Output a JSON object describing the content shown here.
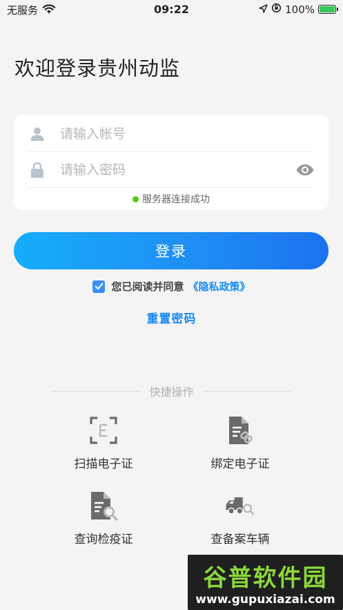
{
  "status_bar": {
    "carrier": "无服务",
    "time": "09:22",
    "battery": "100%"
  },
  "welcome_title": "欢迎登录贵州动监",
  "form": {
    "account_placeholder": "请输入帐号",
    "password_placeholder": "请输入密码",
    "connection_status": "服务器连接成功"
  },
  "login_button": "登录",
  "agreement": {
    "text": "您已阅读并同意",
    "policy_link": "《隐私政策》",
    "checked": true
  },
  "reset_password": "重置密码",
  "quick_actions": {
    "title": "快捷操作",
    "items": [
      {
        "label": "扫描电子证",
        "icon": "scan-certificate-icon"
      },
      {
        "label": "绑定电子证",
        "icon": "bind-certificate-icon"
      },
      {
        "label": "查询检疫证",
        "icon": "query-quarantine-icon"
      },
      {
        "label": "查备案车辆",
        "icon": "check-vehicle-icon"
      }
    ]
  },
  "watermark": {
    "title": "谷普软件园",
    "url": "www.gupuxiazai.com"
  },
  "colors": {
    "accent": "#1a8af3",
    "button_gradient_start": "#16adfb",
    "button_gradient_end": "#1a73f0",
    "success_dot": "#52d017",
    "icon_gray": "#6b6b6b"
  }
}
